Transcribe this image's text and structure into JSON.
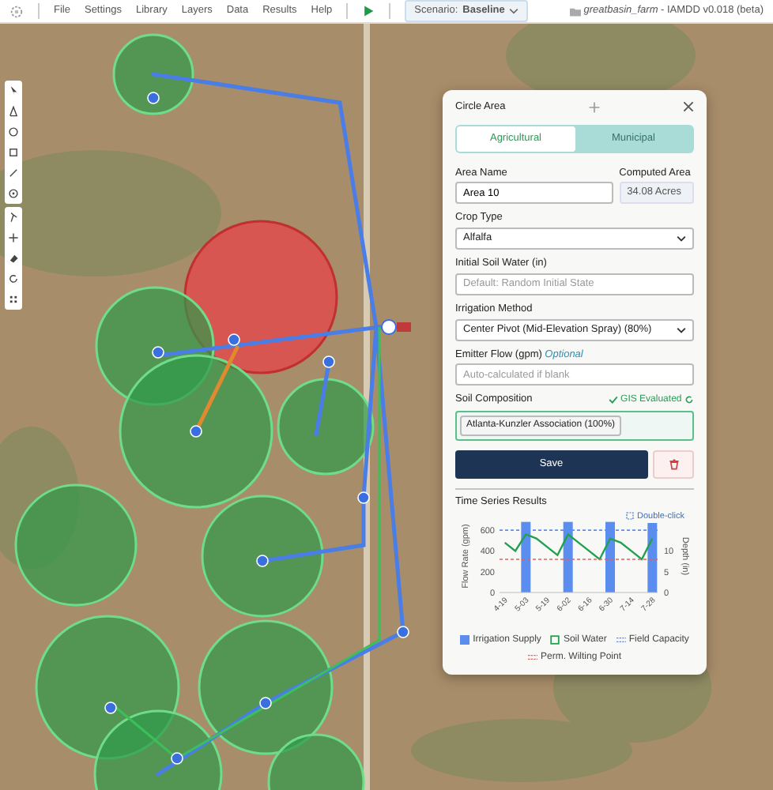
{
  "menu": {
    "items": [
      "File",
      "Settings",
      "Library",
      "Layers",
      "Data",
      "Results",
      "Help"
    ],
    "scenario_label": "Scenario:",
    "scenario": "Baseline",
    "project": "greatbasin_farm",
    "separator": "-",
    "version": "IAMDD v0.018 (beta)"
  },
  "tools": [
    {
      "kind": "pointer"
    },
    {
      "kind": "polygon"
    },
    {
      "kind": "circle"
    },
    {
      "kind": "square"
    },
    {
      "kind": "line"
    },
    {
      "kind": "target"
    },
    {
      "kind": "pivot"
    },
    {
      "kind": "move"
    },
    {
      "kind": "erase"
    },
    {
      "kind": "rotate"
    },
    {
      "kind": "grid"
    }
  ],
  "map": {
    "fields": [
      {
        "selected": false
      },
      {
        "selected": true
      },
      {
        "selected": false
      },
      {
        "selected": false
      },
      {
        "selected": false
      },
      {
        "selected": false
      },
      {
        "selected": false
      },
      {
        "selected": false
      },
      {
        "selected": false
      },
      {
        "selected": false
      },
      {
        "selected": false
      }
    ]
  },
  "panel": {
    "title": "Circle Area",
    "tabs": [
      {
        "label": "Agricultural",
        "selected": true
      },
      {
        "label": "Municipal",
        "selected": false
      }
    ],
    "area_name": {
      "label": "Area Name",
      "value": "Area 10"
    },
    "computed_area": {
      "label": "Computed Area",
      "value": "34.08 Acres"
    },
    "crop_type": {
      "label": "Crop Type",
      "value": "Alfalfa"
    },
    "initial_soil_water": {
      "label": "Initial Soil Water (in)",
      "placeholder": "Default: Random Initial State"
    },
    "irrigation_method": {
      "label": "Irrigation Method",
      "value": "Center Pivot (Mid-Elevation Spray) (80%)"
    },
    "emitter_flow": {
      "label": "Emitter Flow (gpm)",
      "note": "Optional",
      "placeholder": "Auto-calculated if blank"
    },
    "soil": {
      "label": "Soil Composition",
      "status": "GIS Evaluated",
      "tags": [
        "Atlanta-Kunzler Association (100%)"
      ]
    },
    "save": "Save",
    "results": {
      "title": "Time Series Results",
      "hint": "Double-click",
      "chart_data": {
        "type": "bar",
        "ylabel": "Flow Rate (gpm)",
        "y2label": "Depth (in)",
        "categories": [
          "4-19",
          null,
          "5-03",
          null,
          "5-19",
          null,
          "6-02",
          null,
          "6-16",
          null,
          "6-30",
          null,
          "7-14",
          null,
          "7-28"
        ],
        "ylim": [
          0,
          700
        ],
        "y2lim": [
          0,
          17.5
        ],
        "yticks": [
          0,
          200,
          400,
          600
        ],
        "y2ticks": [
          0,
          5,
          10
        ],
        "series": [
          {
            "name": "Irrigation Supply",
            "color": "#5b8def",
            "values": [
              null,
              null,
              680,
              null,
              null,
              null,
              680,
              null,
              null,
              null,
              680,
              null,
              null,
              null,
              680
            ]
          },
          {
            "name": "Soil Water",
            "type": "line",
            "color": "#22a050",
            "axis": "y2",
            "values": [
              12,
              10,
              14,
              13,
              11,
              9,
              14,
              12,
              10,
              8,
              13,
              12,
              10,
              8,
              13
            ]
          }
        ],
        "ref_lines": [
          {
            "label": "Field Capacity",
            "color": "#5b8def",
            "value": 15,
            "axis": "y2"
          },
          {
            "label": "Perm. Wilting Point",
            "color": "#e06060",
            "value": 8,
            "axis": "y2"
          }
        ]
      }
    }
  }
}
